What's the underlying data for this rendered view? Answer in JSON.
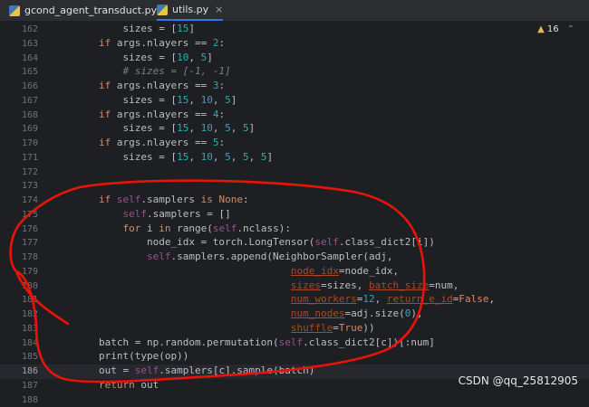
{
  "tabs": [
    {
      "label": "gcond_agent_transduct.py",
      "active": false
    },
    {
      "label": "utils.py",
      "active": true,
      "close": "×"
    }
  ],
  "inspection": {
    "icon": "warning-icon",
    "count": "16"
  },
  "lines": [
    {
      "no": "162",
      "text": "            sizes = [15]"
    },
    {
      "no": "163",
      "text": "        if args.nlayers == 2:"
    },
    {
      "no": "164",
      "text": "            sizes = [10, 5]"
    },
    {
      "no": "165",
      "text": "            # sizes = [-1, -1]"
    },
    {
      "no": "166",
      "text": "        if args.nlayers == 3:"
    },
    {
      "no": "167",
      "text": "            sizes = [15, 10, 5]"
    },
    {
      "no": "168",
      "text": "        if args.nlayers == 4:"
    },
    {
      "no": "169",
      "text": "            sizes = [15, 10, 5, 5]"
    },
    {
      "no": "170",
      "text": "        if args.nlayers == 5:"
    },
    {
      "no": "171",
      "text": "            sizes = [15, 10, 5, 5, 5]"
    },
    {
      "no": "172",
      "text": ""
    },
    {
      "no": "173",
      "text": ""
    },
    {
      "no": "174",
      "text": "        if self.samplers is None:"
    },
    {
      "no": "175",
      "text": "            self.samplers = []"
    },
    {
      "no": "176",
      "text": "            for i in range(self.nclass):"
    },
    {
      "no": "177",
      "text": "                node_idx = torch.LongTensor(self.class_dict2[i])"
    },
    {
      "no": "178",
      "text": "                self.samplers.append(NeighborSampler(adj,"
    },
    {
      "no": "179",
      "text": "                                        node_idx=node_idx,"
    },
    {
      "no": "180",
      "text": "                                        sizes=sizes, batch_size=num,"
    },
    {
      "no": "181",
      "text": "                                        num_workers=12, return_e_id=False,"
    },
    {
      "no": "182",
      "text": "                                        num_nodes=adj.size(0),"
    },
    {
      "no": "183",
      "text": "                                        shuffle=True))"
    },
    {
      "no": "184",
      "text": "        batch = np.random.permutation(self.class_dict2[c])[:num]"
    },
    {
      "no": "185",
      "text": "        print(type(op))"
    },
    {
      "no": "186",
      "text": "        out = self.samplers[c].sample(batch)",
      "current": true
    },
    {
      "no": "187",
      "text": "        return out"
    },
    {
      "no": "188",
      "text": ""
    }
  ],
  "watermark": "CSDN @qq_25812905",
  "colors": {
    "background": "#1e1f22",
    "keyword": "#cf8e6d",
    "number": "#2aacb8",
    "self": "#94558d",
    "annotation": "#e8140a"
  }
}
